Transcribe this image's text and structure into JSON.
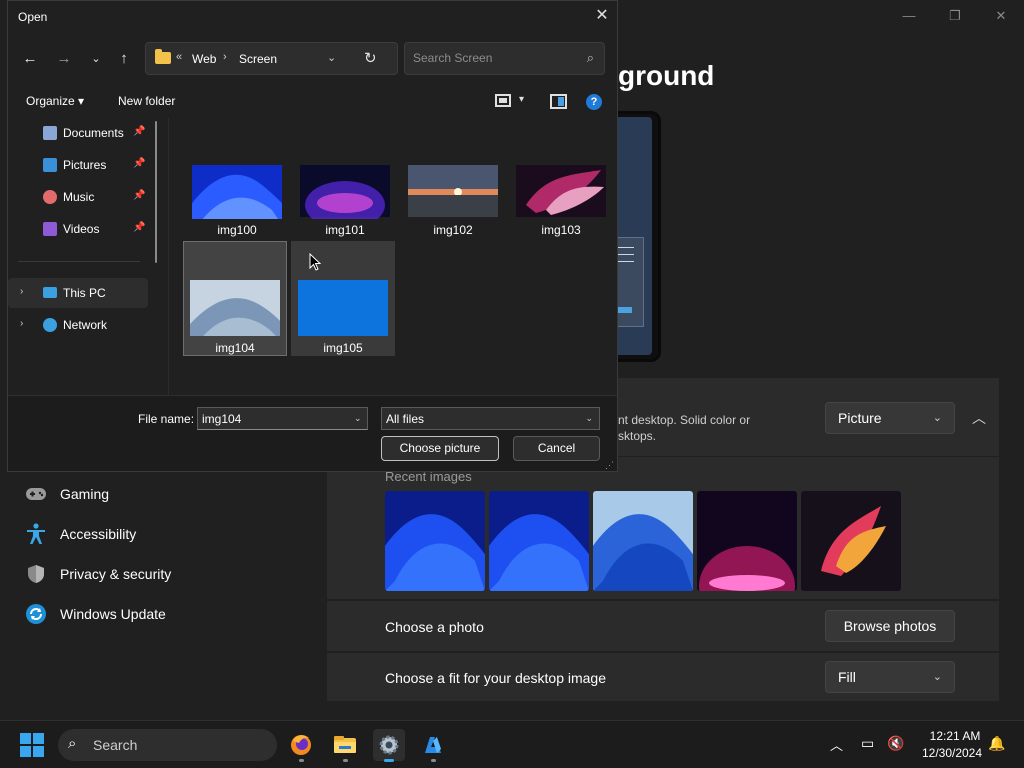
{
  "settings": {
    "heading_visible": "ground",
    "window_controls": {
      "minimize": "—",
      "maximize": "❐",
      "close": "✕"
    },
    "personalize_desc_line1": "nt desktop. Solid color or",
    "personalize_desc_line2": "sktops.",
    "background_type": "Picture",
    "recent_images_label": "Recent images",
    "choose_photo_label": "Choose a photo",
    "browse_photos": "Browse photos",
    "fit_label": "Choose a fit for your desktop image",
    "fit_value": "Fill",
    "nav": [
      {
        "label": "Gaming",
        "icon": "gamepad-icon"
      },
      {
        "label": "Accessibility",
        "icon": "accessibility-icon"
      },
      {
        "label": "Privacy & security",
        "icon": "shield-icon"
      },
      {
        "label": "Windows Update",
        "icon": "update-icon"
      }
    ],
    "accent": "#39a7f0"
  },
  "dialog": {
    "title": "Open",
    "close": "✕",
    "address": {
      "sep0": "«",
      "segment1": "Web",
      "sep1": "›",
      "segment2": "Screen"
    },
    "search_placeholder": "Search Screen",
    "organize": "Organize ▾",
    "new_folder": "New folder",
    "help": "?",
    "nav_items": [
      {
        "label": "Documents",
        "icon": "documents-icon",
        "pinned": true
      },
      {
        "label": "Pictures",
        "icon": "pictures-icon",
        "pinned": true
      },
      {
        "label": "Music",
        "icon": "music-icon",
        "pinned": true
      },
      {
        "label": "Videos",
        "icon": "videos-icon",
        "pinned": true
      },
      {
        "label": "This PC",
        "icon": "pc-icon",
        "expandable": true,
        "selected": true
      },
      {
        "label": "Network",
        "icon": "network-icon",
        "expandable": true
      }
    ],
    "files": [
      {
        "name": "img100"
      },
      {
        "name": "img101"
      },
      {
        "name": "img102"
      },
      {
        "name": "img103"
      },
      {
        "name": "img104",
        "selected": true
      },
      {
        "name": "img105",
        "hover": true
      }
    ],
    "file_name_label": "File name:",
    "file_name_value": "img104",
    "file_type": "All files",
    "choose_button": "Choose picture",
    "cancel_button": "Cancel"
  },
  "taskbar": {
    "search_label": "Search",
    "apps": [
      "firefox-icon",
      "file-explorer-icon",
      "settings-icon",
      "azure-icon"
    ],
    "time": "12:21 AM",
    "date": "12/30/2024"
  }
}
